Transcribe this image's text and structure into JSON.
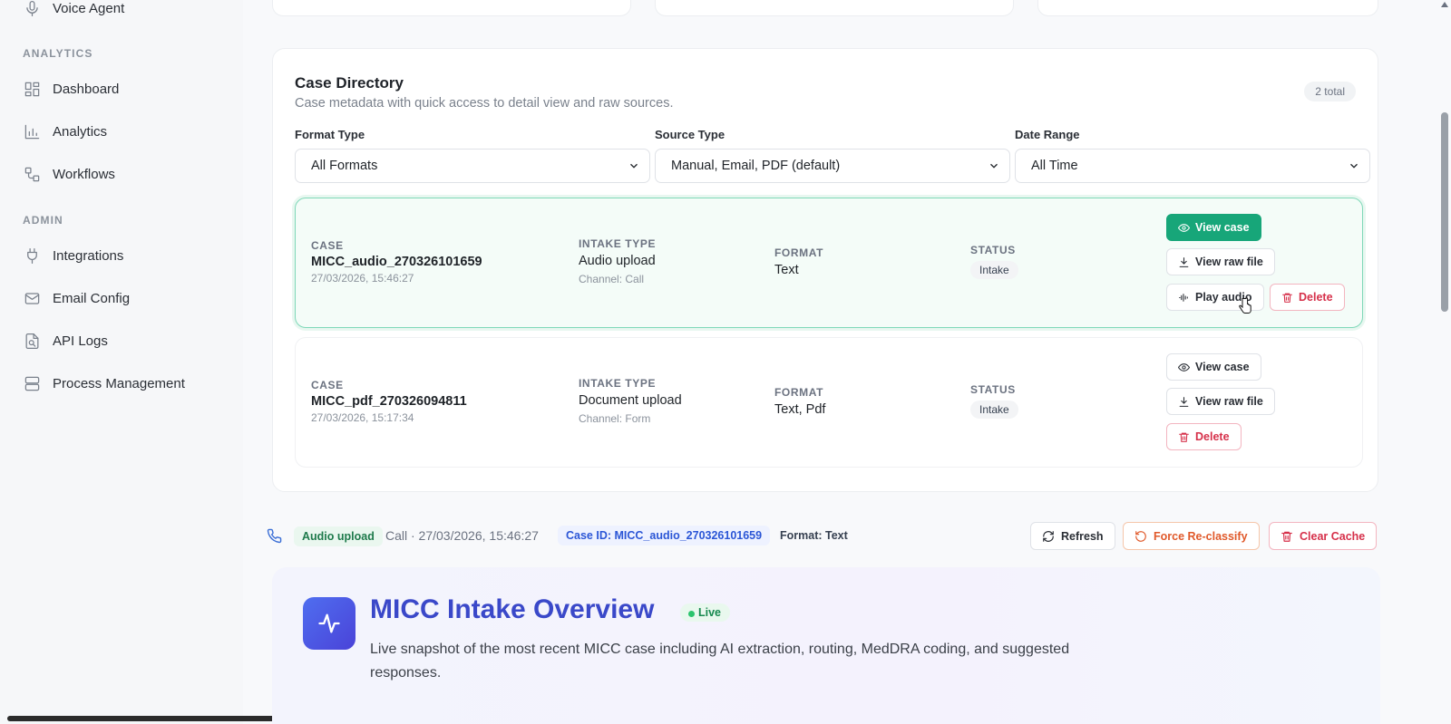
{
  "sidebar": {
    "top_item": {
      "label": "Voice Agent",
      "icon": "microphone-icon"
    },
    "analytics_label": "ANALYTICS",
    "analytics_items": [
      {
        "label": "Dashboard",
        "icon": "dashboard-icon"
      },
      {
        "label": "Analytics",
        "icon": "bar-chart-icon"
      },
      {
        "label": "Workflows",
        "icon": "workflow-icon"
      }
    ],
    "admin_label": "ADMIN",
    "admin_items": [
      {
        "label": "Integrations",
        "icon": "plug-icon"
      },
      {
        "label": "Email Config",
        "icon": "mail-icon"
      },
      {
        "label": "API Logs",
        "icon": "file-search-icon"
      },
      {
        "label": "Process Management",
        "icon": "server-icon"
      }
    ]
  },
  "directory": {
    "title": "Case Directory",
    "subtitle": "Case metadata with quick access to detail view and raw sources.",
    "total": "2 total",
    "filters": [
      {
        "label": "Format Type",
        "value": "All Formats"
      },
      {
        "label": "Source Type",
        "value": "Manual, Email, PDF (default)"
      },
      {
        "label": "Date Range",
        "value": "All Time"
      }
    ],
    "column_labels": {
      "case": "CASE",
      "intake": "INTAKE TYPE",
      "format": "FORMAT",
      "status": "STATUS"
    },
    "cases": [
      {
        "id": "MICC_audio_270326101659",
        "datetime": "27/03/2026, 15:46:27",
        "intake_type": "Audio upload",
        "channel": "Channel: Call",
        "format": "Text",
        "status": "Intake",
        "actions": {
          "view_case": "View case",
          "view_raw": "View raw file",
          "play_audio": "Play audio",
          "delete": "Delete"
        }
      },
      {
        "id": "MICC_pdf_270326094811",
        "datetime": "27/03/2026, 15:17:34",
        "intake_type": "Document upload",
        "channel": "Channel: Form",
        "format": "Text, Pdf",
        "status": "Intake",
        "actions": {
          "view_case": "View case",
          "view_raw": "View raw file",
          "delete": "Delete"
        }
      }
    ]
  },
  "strip": {
    "intake_tag": "Audio upload",
    "call_info": "Call · 27/03/2026, 15:46:27",
    "case_id": "Case ID: MICC_audio_270326101659",
    "format": "Format: Text",
    "refresh": "Refresh",
    "force_reclassify": "Force Re-classify",
    "clear_cache": "Clear Cache"
  },
  "overview": {
    "title": "MICC Intake Overview",
    "live": "Live",
    "description": "Live snapshot of the most recent MICC case including AI extraction, routing, MedDRA coding, and suggested responses."
  },
  "colors": {
    "primary_green": "#17a679",
    "danger": "#d6304a",
    "accent_blue": "#3a48c9",
    "orange": "#e0592a"
  }
}
